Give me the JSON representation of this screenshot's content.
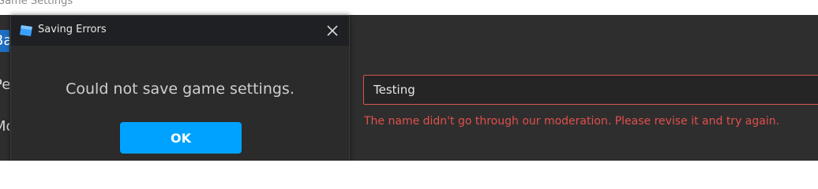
{
  "window": {
    "title": "Game Settings"
  },
  "left_nav": {
    "items": [
      {
        "label": "Basic Info",
        "active": true
      },
      {
        "label": "Permissions",
        "active": false
      },
      {
        "label": "Monetization",
        "active": false
      }
    ]
  },
  "form": {
    "name_value": "Testing",
    "error_message": "The name didn't go through our moderation. Please revise it and try again."
  },
  "dialog": {
    "title": "Saving Errors",
    "close_glyph": "✕",
    "message": "Could not save game settings.",
    "ok_label": "OK"
  },
  "colors": {
    "accent": "#00a2ff",
    "error": "#e0504c",
    "nav_active": "#1f6fc2"
  }
}
